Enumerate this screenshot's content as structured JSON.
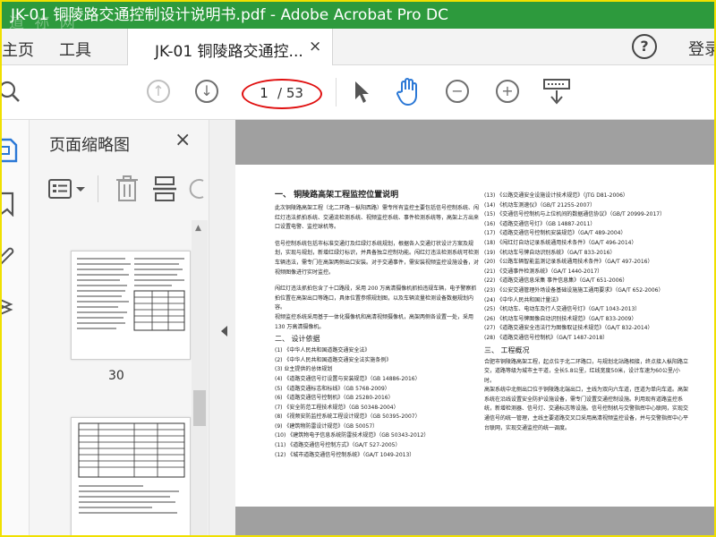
{
  "window": {
    "title": "JK-01 铜陵路交通控制设计说明书.pdf - Adobe Acrobat Pro DC",
    "watermark": "道 祢 网"
  },
  "tabs": {
    "home": "主页",
    "tools": "工具",
    "doc": "JK-01 铜陵路交通控...",
    "close": "×",
    "help": "?",
    "signin": "登录"
  },
  "toolbar": {
    "current_page": "1",
    "total_pages": "/ 53",
    "icons": [
      "search-icon",
      "page-up-icon",
      "page-down-icon",
      "select-arrow-icon",
      "hand-tool-icon",
      "zoom-out-icon",
      "zoom-in-icon",
      "keyboard-scroll-icon"
    ]
  },
  "panel": {
    "title": "页面缩略图",
    "close": "×",
    "thumb_page_label": "30"
  },
  "colors": {
    "titlebar": "#2d9a3d",
    "highlight_oval": "#e01010",
    "hand_icon": "#2b78d6",
    "rail_icon": "#2b78d6"
  },
  "doc": {
    "left": {
      "h1": "一、 铜陵路高架工程监控位置说明",
      "p1": "此次铜陵路高架工程（北二环路－枞阳西路）需专所有监控主要包括信号控制系统、闯红灯违法抓拍系统、交通流检测系统、视频监控系统、事件检测系统等，高架上方出来口设置电警、监控球机等。",
      "p2": "信号控制系统包括市标准交通灯及红绿灯系统规划，根据各入交通灯状设计方案及规划，实现与规划，新增红绿灯标识，并具备独立控制功能。闯红灯违法检测系统可检测车辆违法，需专门在高架两侧出口安装。对于交通事件，需安装视频监控设施设备，对视频图像进行实时监控。",
      "p3": "闯红灯违法抓拍包含了十口路段，采用 200 万高清摄像机抓拍违规车辆，电子警察抓拍位置在高架出口等路口，具体位置参照规划图，以及车辆流量检测设备数据规划内容。",
      "p4": "视频监控系统采用基于一体化摄像机和高清视频摄像机，高架两侧各设置一处，采用 130 万高清摄像机。",
      "h2": "二、 设计依据",
      "refs": [
        "(1) 《中华人民共和国道路交通安全法》",
        "(2) 《中华人民共和国道路交通安全法实施条例》",
        "(3) 业主提供的总体规划",
        "(4) 《道路交通信号灯设置与安装规范》（GB 14886-2016）",
        "(5) 《道路交通标志和标线》（GB 5768-2009）",
        "(6) 《道路交通信号控制机》（GB 25280-2016）",
        "(7) 《安全防范工程技术规范》（GB 50348-2004）",
        "(8) 《视频安防监控系统工程设计规范》（GB 50395-2007）",
        "(9) 《建筑物防雷设计规范》（GB 50057）",
        "(10) 《建筑物电子信息系统防雷技术规范》（GB 50343-2012）",
        "(11) 《道路交通信号控制方式》（GA/T 527-2005）",
        "(12) 《城市道路交通信号控制系统》（GA/T 1049-2013）"
      ]
    },
    "right": {
      "refs": [
        "(13) 《公路交通安全设施设计技术规范》（JTG D81-2006）",
        "(14) 《机动车测速仪》（GB/T 21255-2007）",
        "(15) 《交通信号控制机与上位机间的数据通信协议》（GB/T 20999-2017）",
        "(16) 《道路交通信号灯》（GB 14887-2011）",
        "(17) 《道路交通信号控制机安装规范》（GA/T 489-2004）",
        "(18) 《闯红灯自动记录系统通用技术条件》（GA/T 496-2014）",
        "(19) 《机动车号牌自动识别系统》（GA/T 833-2016）",
        "(20) 《公路车辆智能监测记录系统通用技术条件》（GA/T 497-2016）",
        "(21) 《交通事件检测系统》（GA/T 1440-2017）",
        "(22) 《道路交通信息采集 事件信息集》（GA/T 651-2006）",
        "(23) 《公安交通管理外场设备基础设施施工通用要求》（GA/T 652-2006）",
        "(24) 《中华人民共和国计量法》",
        "(25) 《机动车、电动车及行人交通信号灯》（GA/T 1043-2013）",
        "(26) 《机动车号牌图像自动识别技术规范》（GA/T 833-2009）",
        "(27) 《道路交通安全违法行为图像取证技术规范》（GA/T 832-2014）",
        "(28) 《道路交通信号控制机》（GA/T 1487-2018）"
      ],
      "h2": "三、 工程概况",
      "p1": "合肥市铜陵路高架工程，起点位于北二环路口，与规划北站路相接，终点接入枞阳路立交，道路等级为城市主干道，全长5.8公里，红线宽度50米，设计车速为60公里/小时。",
      "p2": "高架系统中北侧出口位于铜陵路北端出口，主线为双向六车道，匝道为单向车道。高架系统在沿线设置安全防护设施设备，需专门设置交通控制设施。利用现有道路监控系统，新增检测器、信号灯、交通标志等设施。信号控制机与交警指挥中心联网，实现交通信号的统一管理，主线主要道路交叉口采用高清视频监控设备，并与交警指挥中心平台联网，实现交通监控的统一调度。"
    }
  }
}
